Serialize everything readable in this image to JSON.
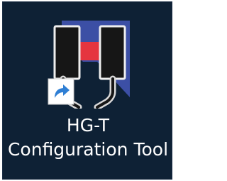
{
  "desktop_icon": {
    "label_line1": "HG-T",
    "label_line2": "Configuration Tool",
    "icon": "hg-t-sensor-app-icon",
    "overlay_icon": "shortcut-arrow-icon",
    "colors": {
      "tile_background": "#0e2135",
      "label_text": "#ffffff",
      "sensor_body": "#161616",
      "sensor_outline": "#eeeeee",
      "beam": "#e5353f",
      "backdrop_blue": "#3c4fa5",
      "shortcut_arrow": "#2f7fd4"
    }
  }
}
